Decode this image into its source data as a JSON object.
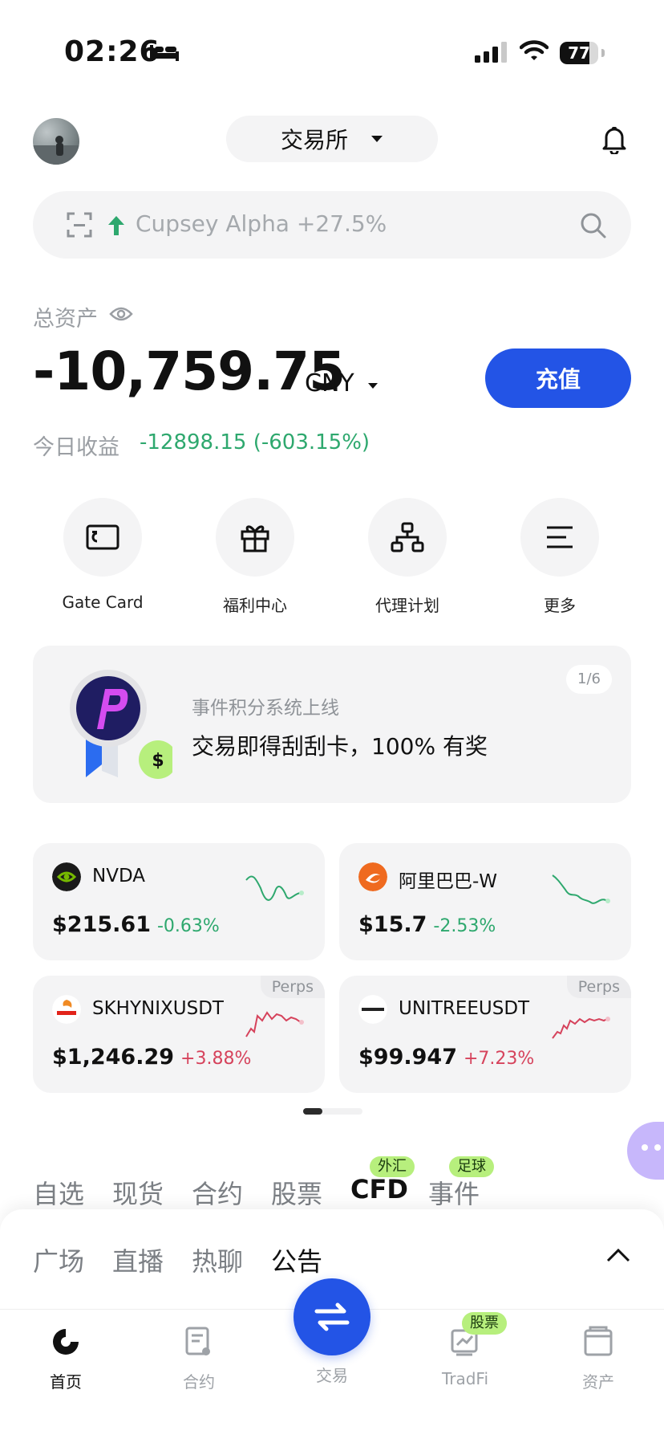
{
  "status_bar": {
    "time": "02:26",
    "battery": "77",
    "battery_level": 0.77
  },
  "header": {
    "exchange_label": "交易所"
  },
  "search": {
    "placeholder": "Cupsey Alpha +27.5%"
  },
  "balance": {
    "label": "总资产",
    "value": "-10,759.75",
    "currency": "CNY",
    "deposit_label": "充值",
    "today_label": "今日收益",
    "today_value": "-12898.15 (-603.15%)"
  },
  "shortcuts": [
    {
      "label": "Gate Card",
      "icon": "card-icon"
    },
    {
      "label": "福利中心",
      "icon": "gift-icon"
    },
    {
      "label": "代理计划",
      "icon": "hierarchy-icon"
    },
    {
      "label": "更多",
      "icon": "menu-icon"
    }
  ],
  "banner": {
    "subtitle": "事件积分系统上线",
    "title": "交易即得刮刮卡，100% 有奖",
    "pager": "1/6"
  },
  "tickers": [
    {
      "name": "NVDA",
      "price": "$215.61",
      "change": "-0.63%",
      "trend": "down",
      "perps": ""
    },
    {
      "name": "阿里巴巴-W",
      "price": "$15.7",
      "change": "-2.53%",
      "trend": "down",
      "perps": ""
    },
    {
      "name": "SKHYNIXUSDT",
      "price": "$1,246.29",
      "change": "+3.88%",
      "trend": "up",
      "perps": "Perps"
    },
    {
      "name": "UNITREEUSDT",
      "price": "$99.947",
      "change": "+7.23%",
      "trend": "up",
      "perps": "Perps"
    }
  ],
  "market_tabs": [
    {
      "label": "自选",
      "badge": ""
    },
    {
      "label": "现货",
      "badge": ""
    },
    {
      "label": "合约",
      "badge": ""
    },
    {
      "label": "股票",
      "badge": ""
    },
    {
      "label": "CFD",
      "badge": "外汇"
    },
    {
      "label": "事件",
      "badge": "足球"
    }
  ],
  "feed_tabs": [
    {
      "label": "广场"
    },
    {
      "label": "直播"
    },
    {
      "label": "热聊"
    },
    {
      "label": "公告"
    }
  ],
  "bottom_nav": [
    {
      "label": "首页",
      "icon": "home-icon"
    },
    {
      "label": "合约",
      "icon": "contract-icon"
    },
    {
      "label": "交易",
      "icon": "swap-icon"
    },
    {
      "label": "TradFi",
      "icon": "tradfi-icon",
      "badge": "股票"
    },
    {
      "label": "资产",
      "icon": "wallet-icon"
    }
  ],
  "colors": {
    "accent": "#2354e6",
    "up": "#d6435c",
    "down": "#2ea86e",
    "badge": "#b7ef7d"
  }
}
